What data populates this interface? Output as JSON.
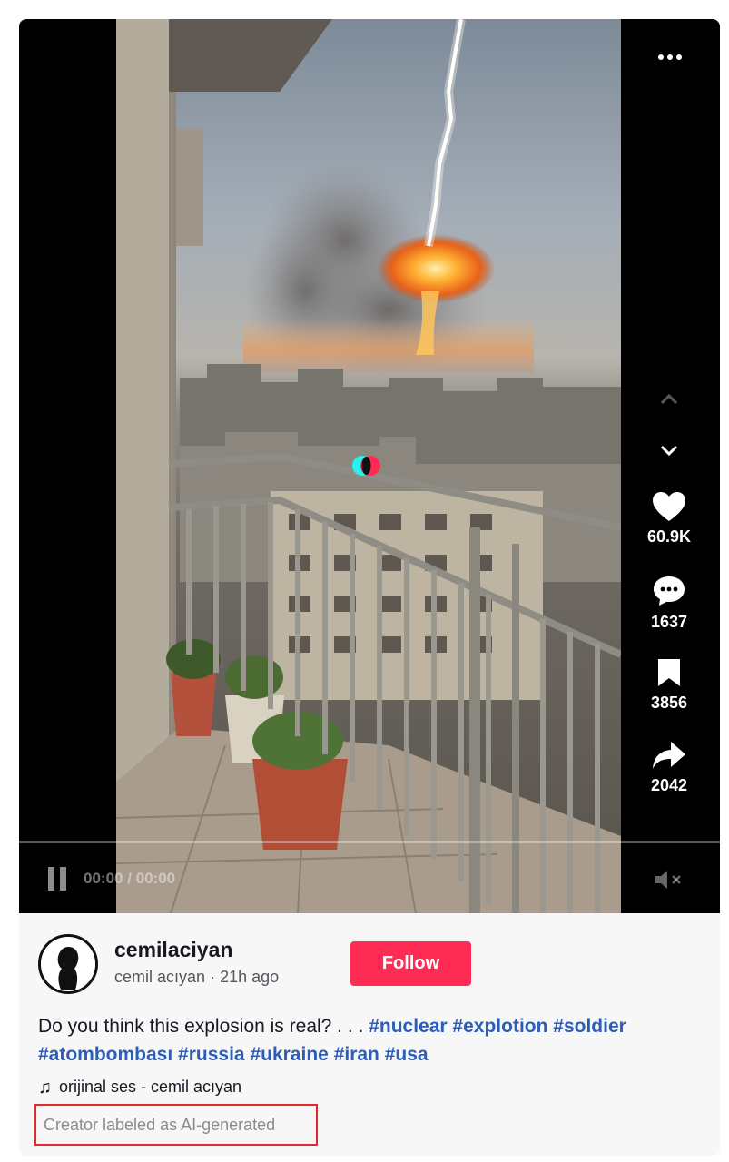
{
  "video": {
    "more_icon": "ellipsis-icon",
    "time_current": "00:00",
    "time_total": "00:00",
    "progress": 0,
    "nav_up_icon": "chevron-up-icon",
    "nav_down_icon": "chevron-down-icon",
    "play_icon": "pause-icon",
    "mute_icon": "muted-speaker-icon"
  },
  "actions": {
    "likes": "60.9K",
    "comments": "1637",
    "saves": "3856",
    "shares": "2042"
  },
  "author": {
    "username": "cemilaciyan",
    "display_name": "cemil acıyan",
    "separator": "·",
    "posted": "21h ago",
    "follow_label": "Follow"
  },
  "caption": {
    "text": "Do you think this explosion is real? . . .",
    "hashtags": [
      "#nuclear",
      "#explotion",
      "#soldier",
      "#atombombası",
      "#russia",
      "#ukraine",
      "#iran",
      "#usa"
    ]
  },
  "music": {
    "icon": "music-note-icon",
    "label": "orijinal ses - cemil acıyan"
  },
  "ai_label": "Creator labeled as AI-generated",
  "colors": {
    "accent": "#fe2c55",
    "hashtag": "#2b5db9",
    "highlight_box": "#e12b2b"
  }
}
